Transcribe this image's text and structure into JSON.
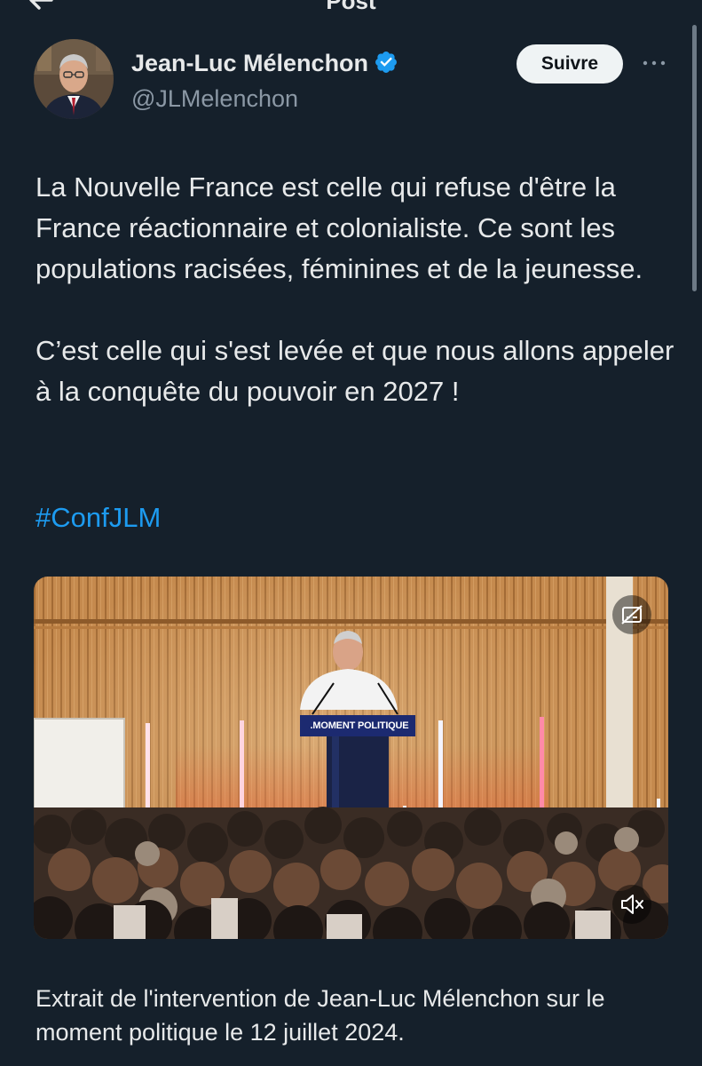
{
  "header": {
    "title": "Post"
  },
  "author": {
    "display_name": "Jean-Luc Mélenchon",
    "handle": "@JLMelenchon",
    "verified": true
  },
  "actions": {
    "follow_label": "Suivre"
  },
  "post": {
    "paragraphs": [
      "La Nouvelle France est celle qui refuse d'être la France réactionnaire et colonialiste. Ce sont les populations racisées, féminines et de la jeunesse.",
      "C’est celle qui s'est levée et que nous allons appeler à la conquête du pouvoir en 2027 !"
    ],
    "hashtag": "#ConfJLM"
  },
  "media": {
    "podium_sign": ".MOMENT POLITIQUE",
    "caption": "Extrait de l'intervention de Jean-Luc Mélenchon sur le moment politique le 12 juillet 2024."
  },
  "icons": {
    "back": "arrow-left-icon",
    "verified": "verified-badge-icon",
    "more": "more-dots-icon",
    "captions": "captions-off-icon",
    "mute": "volume-muted-icon"
  },
  "colors": {
    "background": "#15202b",
    "text": "#e7e9ea",
    "secondary_text": "#8b98a5",
    "link": "#1d9bf0",
    "verified": "#1d9bf0",
    "follow_bg": "#eff3f4"
  }
}
